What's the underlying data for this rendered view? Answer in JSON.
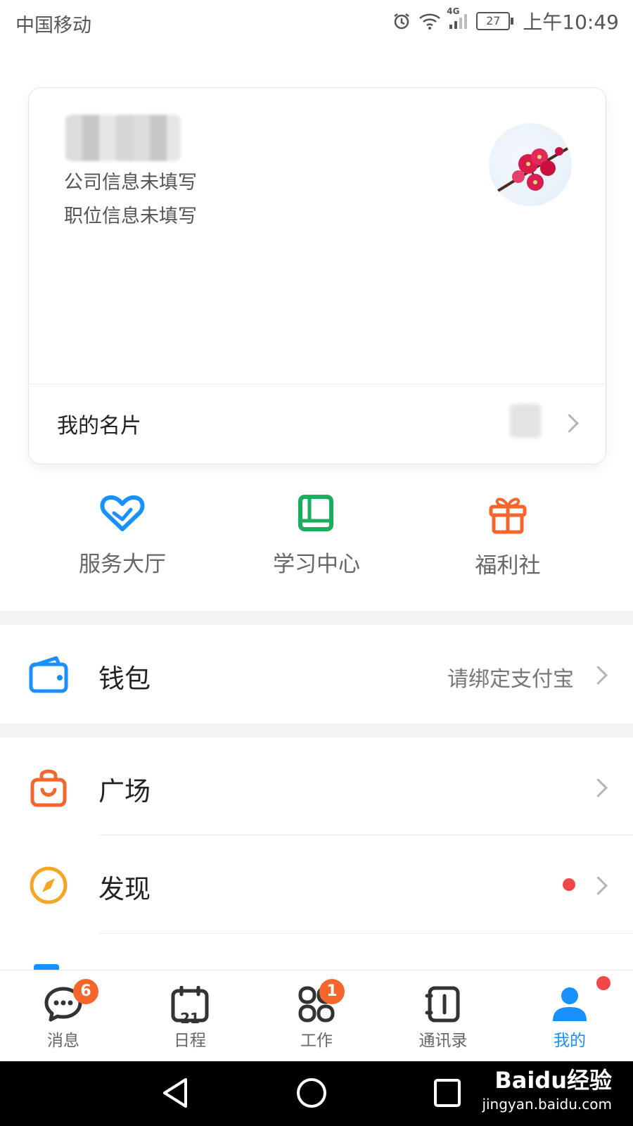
{
  "status_bar": {
    "carrier": "中国移动",
    "network": "4G",
    "battery": "27",
    "time": "上午10:49"
  },
  "profile_card": {
    "company": "公司信息未填写",
    "position": "职位信息未填写",
    "name_card_label": "我的名片"
  },
  "quick_entries": [
    {
      "label": "服务大厅",
      "icon": "heart-icon",
      "color": "#1890ff"
    },
    {
      "label": "学习中心",
      "icon": "book-icon",
      "color": "#1aad5c"
    },
    {
      "label": "福利社",
      "icon": "gift-icon",
      "color": "#f5662d"
    }
  ],
  "wallet": {
    "label": "钱包",
    "value": "请绑定支付宝",
    "icon": "wallet-icon"
  },
  "menu": [
    {
      "label": "广场",
      "icon": "shopping-bag-icon"
    },
    {
      "label": "发现",
      "icon": "compass-icon",
      "has_dot": true
    }
  ],
  "tabs": [
    {
      "label": "消息",
      "badge": "6",
      "icon": "chat-icon"
    },
    {
      "label": "日程",
      "icon": "calendar-icon",
      "calendar_day": "21"
    },
    {
      "label": "工作",
      "badge": "1",
      "icon": "apps-icon"
    },
    {
      "label": "通讯录",
      "icon": "contacts-icon"
    },
    {
      "label": "我的",
      "icon": "user-icon",
      "active": true,
      "has_dot": true
    }
  ],
  "watermark": {
    "brand": "Baidu经验",
    "url": "jingyan.baidu.com"
  },
  "colors": {
    "accent": "#1890ff",
    "badge": "#f5662d",
    "dot": "#f04848"
  }
}
